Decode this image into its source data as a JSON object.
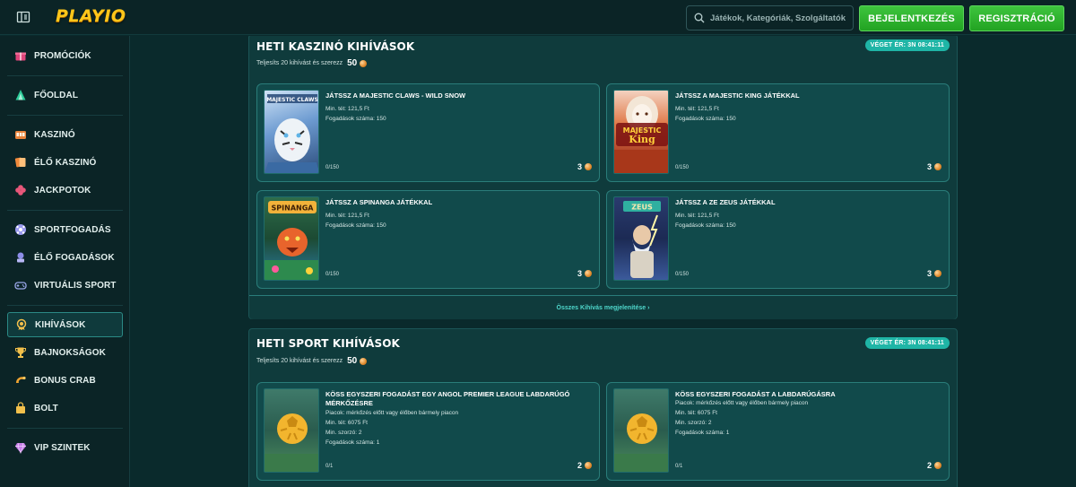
{
  "header": {
    "logo": "PLAYIO",
    "search_placeholder": "Játékok, Kategóriák, Szolgáltatók",
    "login_label": "BEJELENTKEZÉS",
    "register_label": "REGISZTRÁCIÓ"
  },
  "sidebar": {
    "items": [
      {
        "label": "PROMÓCIÓK",
        "icon": "gift-icon"
      },
      {
        "label": "FŐOLDAL",
        "icon": "home-icon"
      },
      {
        "label": "KASZINÓ",
        "icon": "casino-icon"
      },
      {
        "label": "ÉLŐ KASZINÓ",
        "icon": "cards-icon"
      },
      {
        "label": "JACKPOTOK",
        "icon": "clover-icon"
      },
      {
        "label": "SPORTFOGADÁS",
        "icon": "ball-icon"
      },
      {
        "label": "ÉLŐ FOGADÁSOK",
        "icon": "live-icon"
      },
      {
        "label": "VIRTUÁLIS SPORT",
        "icon": "gamepad-icon"
      },
      {
        "label": "KIHÍVÁSOK",
        "icon": "medal-icon"
      },
      {
        "label": "BAJNOKSÁGOK",
        "icon": "trophy-icon"
      },
      {
        "label": "BONUS CRAB",
        "icon": "crab-icon"
      },
      {
        "label": "BOLT",
        "icon": "bag-icon"
      },
      {
        "label": "VIP SZINTEK",
        "icon": "diamond-icon"
      }
    ]
  },
  "casino_challenges": {
    "title": "HETI KASZINÓ KIHÍVÁSOK",
    "subtitle": "Teljesíts 20 kihívást és szerezz",
    "points": "50",
    "ends_badge": "VÉGET ÉR:  3N 08:41:11",
    "view_all": "Összes Kihívás megjelenítése  ›",
    "cards": [
      {
        "title": "JÁTSSZ A MAJESTIC CLAWS - WILD SNOW",
        "min_bet": "Min. tét: 121,5 Ft",
        "bets": "Fogadások száma: 150",
        "progress": "0/150",
        "points": "3",
        "game": "MAJESTIC CLAWS"
      },
      {
        "title": "JÁTSSZ A MAJESTIC KING JÁTÉKKAL",
        "min_bet": "Min. tét: 121,5 Ft",
        "bets": "Fogadások száma: 150",
        "progress": "0/150",
        "points": "3",
        "game": "MAJESTIC KING"
      },
      {
        "title": "JÁTSSZ A SPINANGA JÁTÉKKAL",
        "min_bet": "Min. tét: 121,5 Ft",
        "bets": "Fogadások száma: 150",
        "progress": "0/150",
        "points": "3",
        "game": "SPINANGA"
      },
      {
        "title": "JÁTSSZ A ZE ZEUS JÁTÉKKAL",
        "min_bet": "Min. tét: 121,5 Ft",
        "bets": "Fogadások száma: 150",
        "progress": "0/150",
        "points": "3",
        "game": "ZEUS"
      }
    ]
  },
  "sport_challenges": {
    "title": "HETI SPORT KIHÍVÁSOK",
    "subtitle": "Teljesíts 20 kihívást és szerezz",
    "points": "50",
    "ends_badge": "VÉGET ÉR:  3N 08:41:11",
    "cards": [
      {
        "title": "KÖSS EGYSZERI FOGADÁST EGY ANGOL PREMIER LEAGUE LABDARÚGÓ MÉRKŐZÉSRE",
        "market": "Piacok: mérkőzés előtt vagy élőben bármely piacon",
        "min_bet": "Min. tét: 6075 Ft",
        "min_odds": "Min. szorzó: 2",
        "bets": "Fogadások száma: 1",
        "progress": "0/1",
        "points": "2"
      },
      {
        "title": "KÖSS EGYSZERI FOGADÁST A LABDARÚGÁSRA",
        "market": "Piacok: mérkőzés előtt vagy élőben bármely piacon",
        "min_bet": "Min. tét: 6075 Ft",
        "min_odds": "Min. szorzó: 2",
        "bets": "Fogadások száma: 1",
        "progress": "0/1",
        "points": "2"
      }
    ]
  }
}
